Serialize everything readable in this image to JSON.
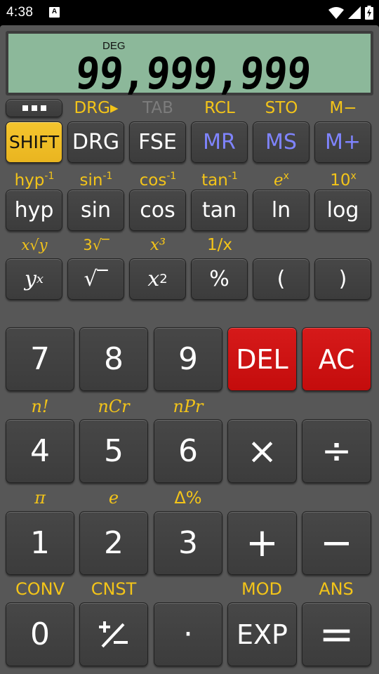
{
  "status_bar": {
    "time": "4:38",
    "notification_icon": "A",
    "icons": [
      "wifi-icon",
      "signal-icon",
      "battery-charging-icon"
    ]
  },
  "display": {
    "angle_mode": "DEG",
    "value": "99,999,999"
  },
  "colors": {
    "body": "#575757",
    "lcd": "#8cb89a",
    "key": "#424242",
    "shift_key": "#f0bd25",
    "red_key": "#cc1010",
    "memory_text": "#7f84ff",
    "secondary_label": "#f3c419",
    "disabled_label": "#7c7c7c"
  },
  "row0": {
    "menu_label": "•••",
    "labels": [
      "DRG▸",
      "TAB",
      "RCL",
      "STO",
      "M−"
    ],
    "keys": [
      "SHIFT",
      "DRG",
      "FSE",
      "MR",
      "MS",
      "M+"
    ]
  },
  "row1": {
    "labels": [
      {
        "base": "hyp",
        "sup": "-1"
      },
      {
        "base": "sin",
        "sup": "-1"
      },
      {
        "base": "cos",
        "sup": "-1"
      },
      {
        "base": "tan",
        "sup": "-1"
      },
      {
        "base": "e",
        "sup": "x"
      },
      {
        "base": "10",
        "sup": "x"
      }
    ],
    "keys": [
      "hyp",
      "sin",
      "cos",
      "tan",
      "ln",
      "log"
    ]
  },
  "row2": {
    "labels": [
      "x√y",
      "3√‾",
      "x³",
      "1/x",
      "",
      ""
    ],
    "keys": [
      {
        "base": "y",
        "sup": "x"
      },
      {
        "base": "√‾"
      },
      {
        "base": "x",
        "sup": "2"
      },
      {
        "base": "%"
      },
      {
        "base": "("
      },
      {
        "base": ")"
      }
    ]
  },
  "grid": {
    "rows": [
      {
        "labels": [
          "",
          "",
          "",
          "",
          ""
        ],
        "keys": [
          "7",
          "8",
          "9",
          "DEL",
          "AC"
        ]
      },
      {
        "labels": [
          "n!",
          "nCr",
          "nPr",
          "",
          ""
        ],
        "keys": [
          "4",
          "5",
          "6",
          "×",
          "÷"
        ]
      },
      {
        "labels": [
          "π",
          "e",
          "Δ%",
          "",
          ""
        ],
        "keys": [
          "1",
          "2",
          "3",
          "+",
          "−"
        ]
      },
      {
        "labels": [
          "CONV",
          "CNST",
          "",
          "MOD",
          "ANS"
        ],
        "keys": [
          "0",
          "±",
          "·",
          "EXP",
          "="
        ]
      }
    ]
  }
}
